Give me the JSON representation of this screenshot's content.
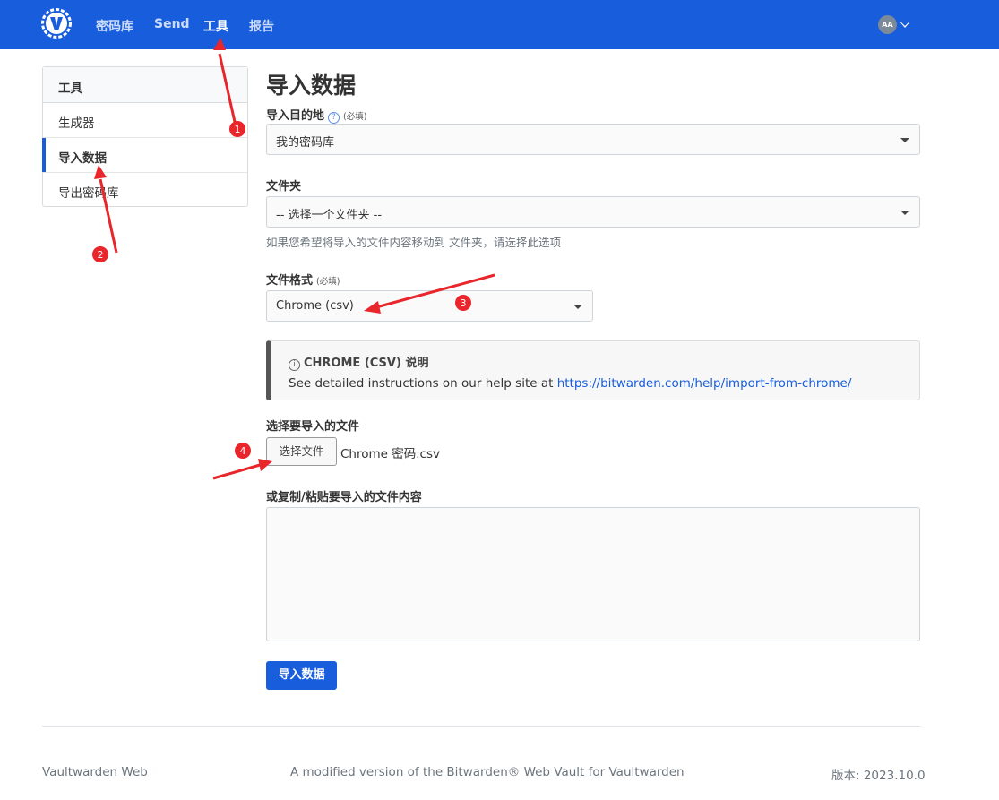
{
  "nav": {
    "links": [
      {
        "label": "密码库"
      },
      {
        "label": "Send"
      },
      {
        "label": "工具"
      },
      {
        "label": "报告"
      }
    ],
    "avatar_initials": "AA",
    "brand_color": "#175ddc"
  },
  "sidebar": {
    "heading": "工具",
    "items": [
      {
        "label": "生成器"
      },
      {
        "label": "导入数据",
        "active": true
      },
      {
        "label": "导出密码库"
      }
    ]
  },
  "main": {
    "title": "导入数据",
    "destination": {
      "label": "导入目的地",
      "required": "(必填)",
      "value": "我的密码库"
    },
    "folder": {
      "label": "文件夹",
      "value": "-- 选择一个文件夹 --",
      "hint": "如果您希望将导入的文件内容移动到 文件夹，请选择此选项"
    },
    "format": {
      "label": "文件格式",
      "required": "(必填)",
      "value": "Chrome (csv)"
    },
    "callout": {
      "title": "CHROME (CSV) 说明",
      "text": "See detailed instructions on our help site at ",
      "link": "https://bitwarden.com/help/import-from-chrome/"
    },
    "file": {
      "label": "选择要导入的文件",
      "button": "选择文件",
      "filename": "Chrome 密码.csv"
    },
    "paste": {
      "label": "或复制/粘贴要导入的文件内容",
      "value": ""
    },
    "submit": "导入数据"
  },
  "footer": {
    "left": "Vaultwarden Web",
    "center": "A modified version of the Bitwarden® Web Vault for Vaultwarden",
    "right": "版本: 2023.10.0"
  },
  "annotations": {
    "markers": [
      "1",
      "2",
      "3",
      "4"
    ],
    "color": "#e8262b"
  }
}
